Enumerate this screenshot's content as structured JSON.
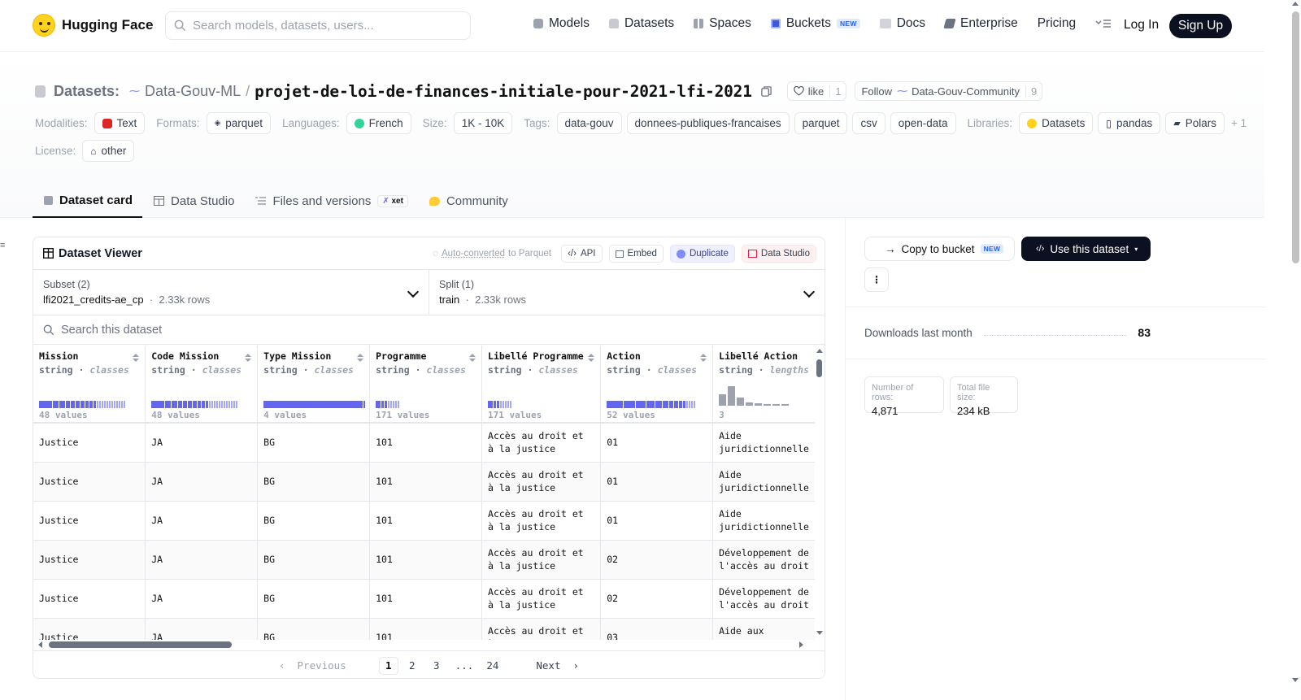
{
  "nav": {
    "logo_text": "Hugging Face",
    "search_placeholder": "Search models, datasets, users...",
    "links": [
      {
        "label": "Models",
        "icon": "cube-icon"
      },
      {
        "label": "Datasets",
        "icon": "database-icon"
      },
      {
        "label": "Spaces",
        "icon": "grid-icon"
      },
      {
        "label": "Buckets",
        "icon": "bucket-icon",
        "badge": "NEW"
      },
      {
        "label": "Docs",
        "icon": "book-icon"
      },
      {
        "label": "Enterprise",
        "icon": "enterprise-icon"
      },
      {
        "label": "Pricing"
      }
    ],
    "login": "Log In",
    "signup": "Sign Up"
  },
  "header": {
    "section_label": "Datasets:",
    "org": "Data-Gouv-ML",
    "separator": "/",
    "repo": "projet-de-loi-de-finances-initiale-pour-2021-lfi-2021",
    "like_label": "like",
    "like_count": "1",
    "follow_label": "Follow",
    "follow_org": "Data-Gouv-Community",
    "follow_count": "9"
  },
  "meta": {
    "modalities_label": "Modalities:",
    "modalities": [
      "Text"
    ],
    "formats_label": "Formats:",
    "formats": [
      "parquet"
    ],
    "languages_label": "Languages:",
    "languages": [
      "French"
    ],
    "size_label": "Size:",
    "size": "1K - 10K",
    "tags_label": "Tags:",
    "tags": [
      "data-gouv",
      "donnees-publiques-francaises",
      "parquet",
      "csv",
      "open-data"
    ],
    "libraries_label": "Libraries:",
    "libraries": [
      "Datasets",
      "pandas",
      "Polars"
    ],
    "libraries_more": "+ 1",
    "license_label": "License:",
    "license": "other"
  },
  "tabs": [
    {
      "label": "Dataset card",
      "active": true
    },
    {
      "label": "Data Studio"
    },
    {
      "label": "Files and versions",
      "badge": "xet"
    },
    {
      "label": "Community"
    }
  ],
  "viewer": {
    "title": "Dataset Viewer",
    "auto_converted": "Auto-converted",
    "to_parquet": "to Parquet",
    "api": "API",
    "embed": "Embed",
    "duplicate": "Duplicate",
    "data_studio": "Data Studio",
    "subset_label": "Subset (2)",
    "subset_value": "lfi2021_credits-ae_cp",
    "subset_rows": "2.33k rows",
    "split_label": "Split (1)",
    "split_value": "train",
    "split_rows": "2.33k rows",
    "search_placeholder": "Search this dataset",
    "columns": [
      {
        "name": "Mission",
        "type": "string",
        "kind": "classes",
        "values": "48 values"
      },
      {
        "name": "Code Mission",
        "type": "string",
        "kind": "classes",
        "values": "48 values"
      },
      {
        "name": "Type Mission",
        "type": "string",
        "kind": "classes",
        "values": "4 values"
      },
      {
        "name": "Programme",
        "type": "string",
        "kind": "classes",
        "values": "171 values"
      },
      {
        "name": "Libellé Programme",
        "type": "string",
        "kind": "classes",
        "values": "171 values"
      },
      {
        "name": "Action",
        "type": "string",
        "kind": "classes",
        "values": "52 values"
      },
      {
        "name": "Libellé Action",
        "type": "string",
        "kind": "lengths",
        "values": "3"
      }
    ],
    "rows": [
      [
        "Justice",
        "JA",
        "BG",
        "101",
        "Accès au droit et à la justice",
        "01",
        "Aide juridictionnelle"
      ],
      [
        "Justice",
        "JA",
        "BG",
        "101",
        "Accès au droit et à la justice",
        "01",
        "Aide juridictionnelle"
      ],
      [
        "Justice",
        "JA",
        "BG",
        "101",
        "Accès au droit et à la justice",
        "01",
        "Aide juridictionnelle"
      ],
      [
        "Justice",
        "JA",
        "BG",
        "101",
        "Accès au droit et à la justice",
        "02",
        "Développement de l'accès au droit"
      ],
      [
        "Justice",
        "JA",
        "BG",
        "101",
        "Accès au droit et à la justice",
        "02",
        "Développement de l'accès au droit"
      ],
      [
        "Justice",
        "JA",
        "BG",
        "101",
        "Accès au droit et à la justice",
        "03",
        "Aide aux victimes"
      ]
    ],
    "pager": {
      "previous": "Previous",
      "pages": [
        "1",
        "2",
        "3",
        "...",
        "24"
      ],
      "current": "1",
      "next": "Next"
    }
  },
  "sidebar": {
    "copy_to_bucket": "Copy to bucket",
    "new_badge": "NEW",
    "use_dataset": "Use this dataset",
    "downloads_label": "Downloads last month",
    "downloads_value": "83",
    "rows_label": "Number of rows:",
    "rows_value": "4,871",
    "size_label": "Total file size:",
    "size_value": "234 kB"
  },
  "colors": {
    "accent_indigo": "#6366f1",
    "dark_button": "#0b1120",
    "new_badge_blue": "#2563eb",
    "logo_yellow": "#ffd21e"
  }
}
